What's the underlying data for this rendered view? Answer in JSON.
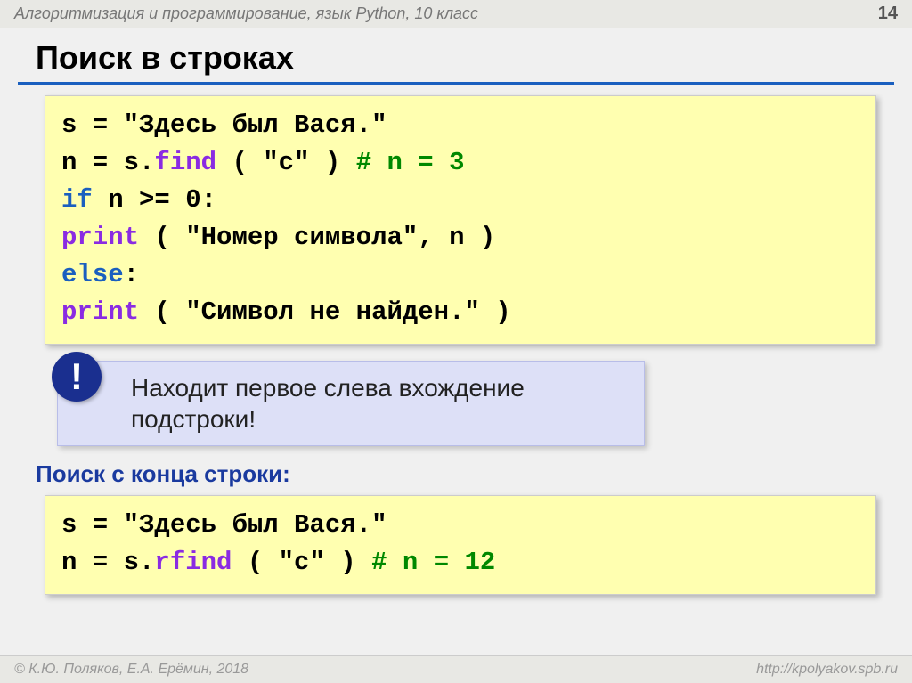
{
  "header": {
    "title": "Алгоритмизация и программирование, язык Python, 10 класс",
    "page": "14"
  },
  "title": "Поиск в строках",
  "code1": {
    "l1a": "s = ",
    "l1b": "\"Здесь был Вася.\"",
    "l2a": "n = s.",
    "l2fn": "find",
    "l2b": " ( ",
    "l2c": "\"с\"",
    "l2d": " )",
    "l2cm": "      # n = 3",
    "l3a": "if",
    "l3b": " n >= ",
    "l3n": "0",
    "l3c": ":",
    "l4sp": "  ",
    "l4fn": "print",
    "l4a": " ( ",
    "l4b": "\"Номер символа\"",
    "l4c": ", n )",
    "l5a": "else",
    "l5b": ":",
    "l6sp": "  ",
    "l6fn": "print",
    "l6a": " ( ",
    "l6b": "\"Символ не найден.\"",
    "l6c": " )"
  },
  "callout": {
    "icon": "!",
    "text": "Находит первое слева вхождение подстроки!"
  },
  "subtitle": "Поиск с конца строки:",
  "code2": {
    "l1a": "s = ",
    "l1b": "\"Здесь был Вася.\"",
    "l2a": "n = s.",
    "l2fn": "rfind",
    "l2b": " ( ",
    "l2c": "\"с\"",
    "l2d": " )",
    "l2cm": "        # n = 12"
  },
  "footer": {
    "left": "© К.Ю. Поляков, Е.А. Ерёмин, 2018",
    "right": "http://kpolyakov.spb.ru"
  }
}
